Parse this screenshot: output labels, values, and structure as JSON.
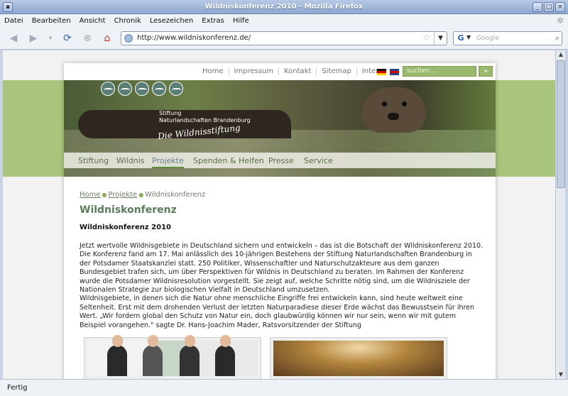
{
  "window": {
    "title": "Wildniskonferenz 2010 - Mozilla Firefox"
  },
  "menu": [
    "Datei",
    "Bearbeiten",
    "Ansicht",
    "Chronik",
    "Lesezeichen",
    "Extras",
    "Hilfe"
  ],
  "nav": {
    "url": "http://www.wildniskonferenz.de/",
    "search_placeholder": "Google"
  },
  "status": "Fertig",
  "site": {
    "toplinks": [
      "Home",
      "Impressum",
      "Kontakt",
      "Sitemap",
      "Intern"
    ],
    "search_placeholder": "suchen...",
    "search_btn": "»",
    "logo_line1": "Stiftung",
    "logo_line2": "Naturlandschaften Brandenburg",
    "signature": "Die Wildnisstiftung",
    "mainnav": [
      "Stiftung",
      "Wildnis",
      "Projekte",
      "Spenden & Helfen",
      "Presse",
      "Service"
    ],
    "mainnav_active": "Projekte",
    "breadcrumb": [
      "Home",
      "Projekte",
      "Wildniskonferenz"
    ],
    "title": "Wildniskonferenz",
    "subtitle": "Wildniskonferenz 2010",
    "paragraph1": "Jetzt wertvolle Wildnisgebiete in Deutschland sichern und entwickeln – das ist die Botschaft der Wildniskonferenz 2010. Die Konferenz fand am 17. Mai anlässlich des 10-jährigen Bestehens der Stiftung Naturlandschaften Brandenburg in der Potsdamer Staatskanzlei statt. 250 Politiker, Wissenschaftler und Naturschutzakteure aus dem ganzen Bundesgebiet trafen sich, um über Perspektiven für Wildnis in Deutschland zu beraten. Im Rahmen der Konferenz wurde die Potsdamer Wildnisresolution vorgestellt. Sie zeigt auf, welche Schritte nötig sind, um die Wildnisziele der Nationalen Strategie zur biologischen Vielfalt in Deutschland umzusetzen.",
    "paragraph2": "Wildnisgebiete, in denen sich die Natur ohne menschliche Eingriffe frei entwickeln kann, sind heute weltweit eine Seltenheit. Erst mit dem drohenden Verlust der letzten Naturparadiese dieser Erde wächst das Bewusstsein für ihren Wert. „Wir fordern global den Schutz von Natur ein, doch glaubwürdig können wir nur sein, wenn wir mit gutem Beispiel vorangehen.\" sagte Dr. Hans-Joachim Mader, Ratsvorsitzender der Stiftung"
  },
  "colors": {
    "accent_green": "#5a7d59",
    "band_green": "#a9c47c"
  }
}
